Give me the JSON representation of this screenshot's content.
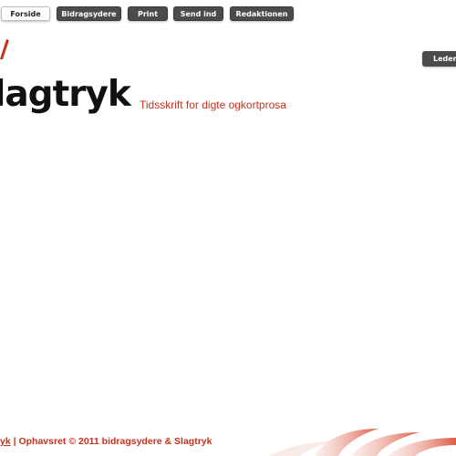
{
  "nav": {
    "items": [
      {
        "label": "Forside",
        "active": true
      },
      {
        "label": "Bidragsydere",
        "active": false
      },
      {
        "label": "Print",
        "active": false
      },
      {
        "label": "Send ind",
        "active": false
      },
      {
        "label": "Redaktionen",
        "active": false
      }
    ]
  },
  "sidebar": {
    "leder_label": "Leder"
  },
  "header": {
    "logo_text": "lagtryk",
    "tagline": "Tidsskrift for digte ogkortprosa"
  },
  "footer": {
    "link_text": "yk",
    "separator": " | ",
    "copyright": "Ophavsret © 2011 bidragsydere & Slagtryk"
  },
  "colors": {
    "accent": "#c2331e",
    "button_dark": "#4b4b4b",
    "logo_text": "#111111"
  }
}
